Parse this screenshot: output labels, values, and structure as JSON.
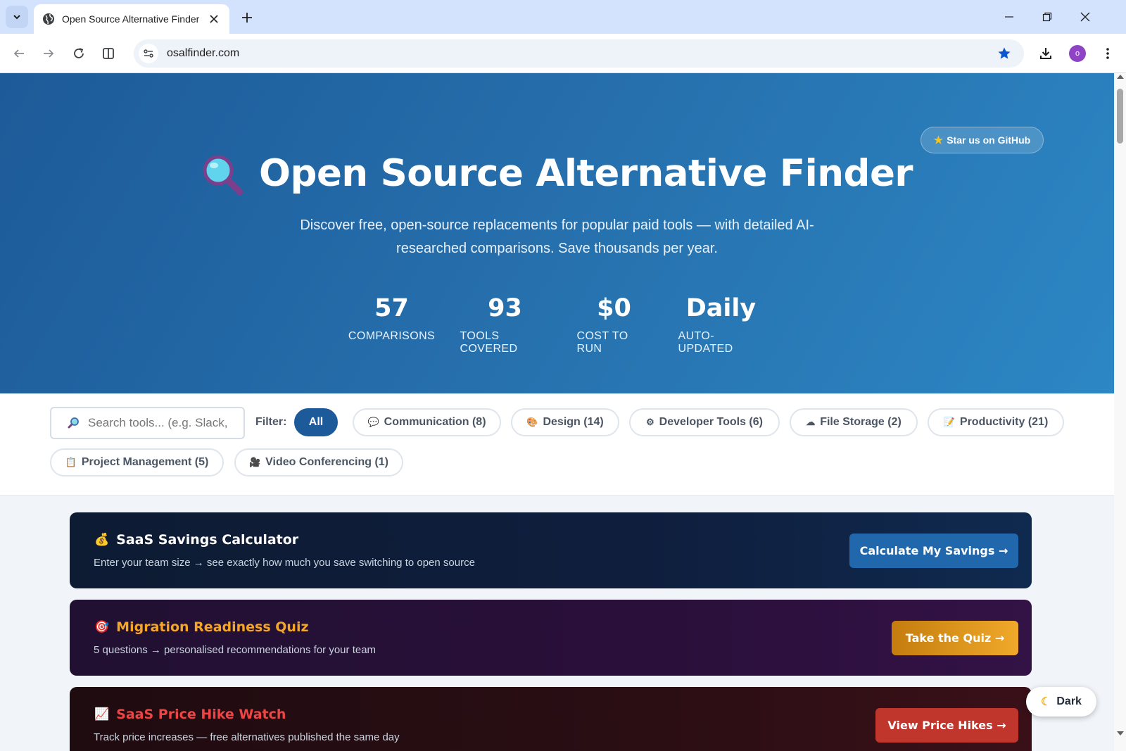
{
  "browser": {
    "tab_title": "Open Source Alternative Finder",
    "url": "osalfinder.com",
    "profile_initial": "o"
  },
  "hero": {
    "github_label": "Star us on GitHub",
    "title": "Open Source Alternative Finder",
    "subtitle": "Discover free, open-source replacements for popular paid tools — with detailed AI-researched comparisons. Save thousands per year.",
    "stats": [
      {
        "value": "57",
        "label": "COMPARISONS"
      },
      {
        "value": "93",
        "label": "TOOLS COVERED"
      },
      {
        "value": "$0",
        "label": "COST TO RUN"
      },
      {
        "value": "Daily",
        "label": "AUTO-UPDATED"
      }
    ]
  },
  "filters": {
    "search_placeholder": "Search tools... (e.g. Slack, Figma)",
    "label": "Filter:",
    "chips": [
      {
        "icon": "",
        "label": "All",
        "active": true
      },
      {
        "icon": "💬",
        "label": "Communication (8)"
      },
      {
        "icon": "🎨",
        "label": "Design (14)"
      },
      {
        "icon": "⚙",
        "label": "Developer Tools (6)"
      },
      {
        "icon": "☁",
        "label": "File Storage (2)"
      },
      {
        "icon": "📝",
        "label": "Productivity (21)"
      },
      {
        "icon": "📋",
        "label": "Project Management (5)"
      },
      {
        "icon": "🎥",
        "label": "Video Conferencing (1)"
      }
    ]
  },
  "cards": [
    {
      "icon": "💰",
      "title": "SaaS Savings Calculator",
      "description": "Enter your team size → see exactly how much you save switching to open source",
      "button": "Calculate My Savings →",
      "title_color": "#ffffff"
    },
    {
      "icon": "🎯",
      "title": "Migration Readiness Quiz",
      "description": "5 questions → personalised recommendations for your team",
      "button": "Take the Quiz →",
      "title_color": "#f5a623"
    },
    {
      "icon": "📈",
      "title": "SaaS Price Hike Watch",
      "description": "Track price increases — free alternatives published the same day",
      "button": "View Price Hikes →",
      "title_color": "#ef4444"
    }
  ],
  "dark_toggle": "Dark"
}
